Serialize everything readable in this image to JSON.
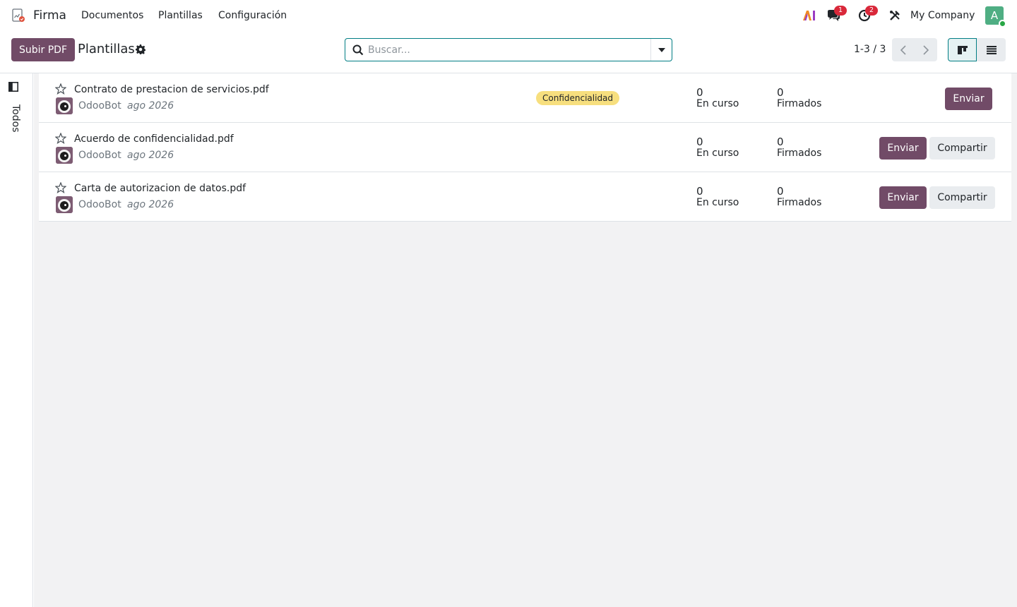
{
  "navbar": {
    "app_name": "Firma",
    "menu": [
      "Documentos",
      "Plantillas",
      "Configuración"
    ],
    "messages_badge": "1",
    "activities_badge": "2",
    "company": "My Company",
    "avatar_initial": "A"
  },
  "control_panel": {
    "upload_button": "Subir PDF",
    "title": "Plantillas",
    "search_placeholder": "Buscar...",
    "pager": "1-3 / 3"
  },
  "side_panel": {
    "filter_label": "Todos"
  },
  "records": [
    {
      "name": "Contrato de prestacion de servicios.pdf",
      "owner": "OdooBot",
      "date": "ago 2026",
      "tag": "Confidencialidad",
      "in_progress": "0",
      "in_progress_label": "En curso",
      "signed": "0",
      "signed_label": "Firmados",
      "send_label": "Enviar",
      "share_label": ""
    },
    {
      "name": "Acuerdo de confidencialidad.pdf",
      "owner": "OdooBot",
      "date": "ago 2026",
      "tag": "",
      "in_progress": "0",
      "in_progress_label": "En curso",
      "signed": "0",
      "signed_label": "Firmados",
      "send_label": "Enviar",
      "share_label": "Compartir"
    },
    {
      "name": "Carta de autorizacion de datos.pdf",
      "owner": "OdooBot",
      "date": "ago 2026",
      "tag": "",
      "in_progress": "0",
      "in_progress_label": "En curso",
      "signed": "0",
      "signed_label": "Firmados",
      "send_label": "Enviar",
      "share_label": "Compartir"
    }
  ],
  "colors": {
    "primary": "#714b67",
    "accent": "#017e84",
    "tag_yellow": "#f7df7e",
    "badge_red": "#d9283a",
    "avatar_green": "#4fae83"
  }
}
